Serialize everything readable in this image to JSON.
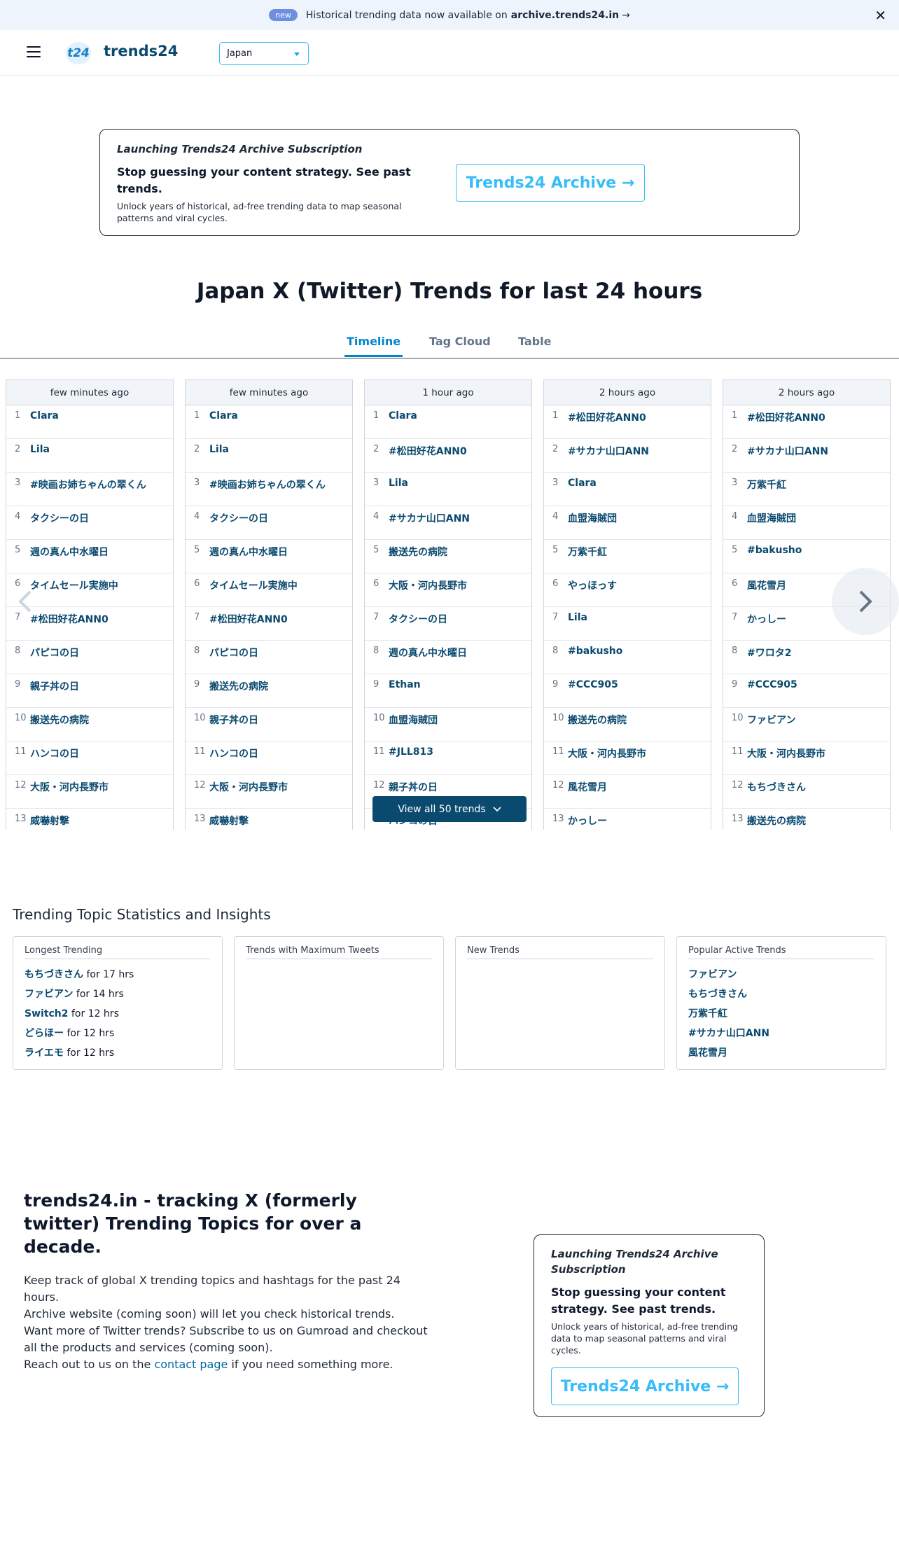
{
  "announcement": {
    "badge": "new",
    "text": "Historical trending data now available on",
    "link": "archive.trends24.in",
    "arrow": "→",
    "close": "✕"
  },
  "header": {
    "logo_mark": "t24",
    "logo_text": "trends24",
    "country": "Japan"
  },
  "promo": {
    "kicker": "Launching Trends24 Archive Subscription",
    "headline": "Stop guessing your content strategy. See past trends.",
    "body": "Unlock years of historical, ad-free trending data to map seasonal patterns and viral cycles.",
    "cta": "Trends24 Archive →"
  },
  "page_title": "Japan X (Twitter) Trends for last 24 hours",
  "tabs": [
    "Timeline",
    "Tag Cloud",
    "Table"
  ],
  "timeline": {
    "columns": [
      {
        "time": "few minutes ago",
        "trends": [
          "Clara",
          "Lila",
          "#映画お姉ちゃんの翠くん",
          "タクシーの日",
          "週の真ん中水曜日",
          "タイムセール実施中",
          "#松田好花ANN0",
          "パピコの日",
          "親子丼の日",
          "搬送先の病院",
          "ハンコの日",
          "大阪・河内長野市",
          "威嚇射撃"
        ]
      },
      {
        "time": "few minutes ago",
        "trends": [
          "Clara",
          "Lila",
          "#映画お姉ちゃんの翠くん",
          "タクシーの日",
          "週の真ん中水曜日",
          "タイムセール実施中",
          "#松田好花ANN0",
          "パピコの日",
          "搬送先の病院",
          "親子丼の日",
          "ハンコの日",
          "大阪・河内長野市",
          "威嚇射撃"
        ]
      },
      {
        "time": "1 hour ago",
        "trends": [
          "Clara",
          "#松田好花ANN0",
          "Lila",
          "#サカナ山口ANN",
          "搬送先の病院",
          "大阪・河内長野市",
          "タクシーの日",
          "週の真ん中水曜日",
          "Ethan",
          "血盟海賊団",
          "#JLL813",
          "親子丼の日",
          "ハンコの日"
        ]
      },
      {
        "time": "2 hours ago",
        "trends": [
          "#松田好花ANN0",
          "#サカナ山口ANN",
          "Clara",
          "血盟海賊団",
          "万紫千紅",
          "やっほっす",
          "Lila",
          "#bakusho",
          "#CCC905",
          "搬送先の病院",
          "大阪・河内長野市",
          "風花雪月",
          "かっしー"
        ]
      },
      {
        "time": "2 hours ago",
        "trends": [
          "#松田好花ANN0",
          "#サカナ山口ANN",
          "万紫千紅",
          "血盟海賊団",
          "#bakusho",
          "風花雪月",
          "かっしー",
          "#ワロタ2",
          "#CCC905",
          "ファビアン",
          "大阪・河内長野市",
          "もちづきさん",
          "搬送先の病院"
        ]
      }
    ],
    "view_all": "View all 50 trends"
  },
  "stats": {
    "title": "Trending Topic Statistics and Insights",
    "cards": [
      {
        "heading": "Longest Trending",
        "items": [
          {
            "name": "もちづきさん",
            "suffix": "for 17 hrs"
          },
          {
            "name": "ファビアン",
            "suffix": "for 14 hrs"
          },
          {
            "name": "Switch2",
            "suffix": "for 12 hrs"
          },
          {
            "name": "どらほー",
            "suffix": "for 12 hrs"
          },
          {
            "name": "ライエモ",
            "suffix": "for 12 hrs"
          }
        ]
      },
      {
        "heading": "Trends with Maximum Tweets",
        "items": []
      },
      {
        "heading": "New Trends",
        "items": []
      },
      {
        "heading": "Popular Active Trends",
        "items": [
          {
            "name": "ファビアン",
            "suffix": ""
          },
          {
            "name": "もちづきさん",
            "suffix": ""
          },
          {
            "name": "万紫千紅",
            "suffix": ""
          },
          {
            "name": "#サカナ山口ANN",
            "suffix": ""
          },
          {
            "name": "風花雪月",
            "suffix": ""
          }
        ]
      }
    ]
  },
  "about": {
    "title": "trends24.in - tracking X (formerly twitter) Trending Topics for over a decade.",
    "line1": "Keep track of global X trending topics and hashtags for the past 24 hours.",
    "line2": "Archive website (coming soon) will let you check historical trends.",
    "line3": "Want more of Twitter trends? Subscribe to us on Gumroad and checkout all the products and services (coming soon).",
    "line4_pre": "Reach out to us on the",
    "line4_link": "contact page",
    "line4_post": "if you need something more."
  },
  "colors": {
    "accent": "#0284c7",
    "brand_dark": "#0b4a6f",
    "cta": "#38bdf8",
    "badge": "#6e8fe0"
  }
}
